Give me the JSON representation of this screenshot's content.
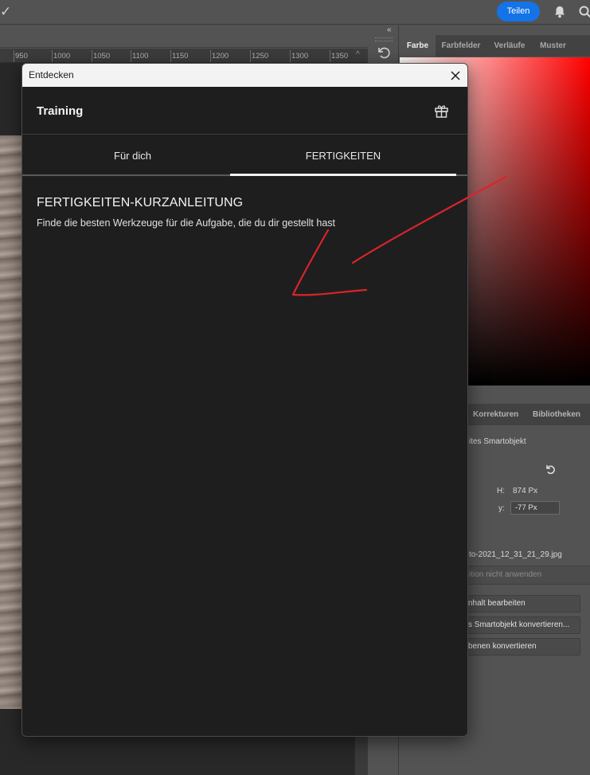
{
  "topbar": {
    "share_label": "Teilen"
  },
  "ruler": {
    "ticks": [
      "950",
      "1000",
      "1050",
      "1100",
      "1150",
      "1200",
      "1250",
      "1300",
      "1350"
    ]
  },
  "color_panel": {
    "tabs": [
      "Farbe",
      "Farbfelder",
      "Verläufe",
      "Muster"
    ],
    "active_tab": "Farbe"
  },
  "properties_panel": {
    "tabs": [
      "Korrekturen",
      "Bibliotheken"
    ],
    "type_label": "ites Smartobjekt",
    "h_label": "H:",
    "h_value": "874 Px",
    "y_label": "y:",
    "y_value": "-77 Px",
    "filename": "to-2021_12_31_21_29.jpg",
    "disabled_option": "ition nicht anwenden",
    "buttons": [
      "nhalt bearbeiten",
      "s Smartobjekt konvertieren...",
      "benen konvertieren"
    ]
  },
  "dialog": {
    "title": "Entdecken",
    "heading": "Training",
    "tabs": [
      "Für dich",
      "FERTIGKEITEN"
    ],
    "active_tab": "FERTIGKEITEN",
    "section_title": "FERTIGKEITEN-KURZANLEITUNG",
    "section_description": "Finde die besten Werkzeuge für die Aufgabe, die du dir gestellt hast"
  },
  "colors": {
    "accent": "#1473e6",
    "annotation": "#d9242b",
    "dialog_bg": "#1e1e1e"
  },
  "icons": [
    "check-icon",
    "bell-icon",
    "search-icon",
    "collapse-panels-icon",
    "history-icon",
    "reset-icon",
    "close-icon",
    "gift-icon"
  ]
}
